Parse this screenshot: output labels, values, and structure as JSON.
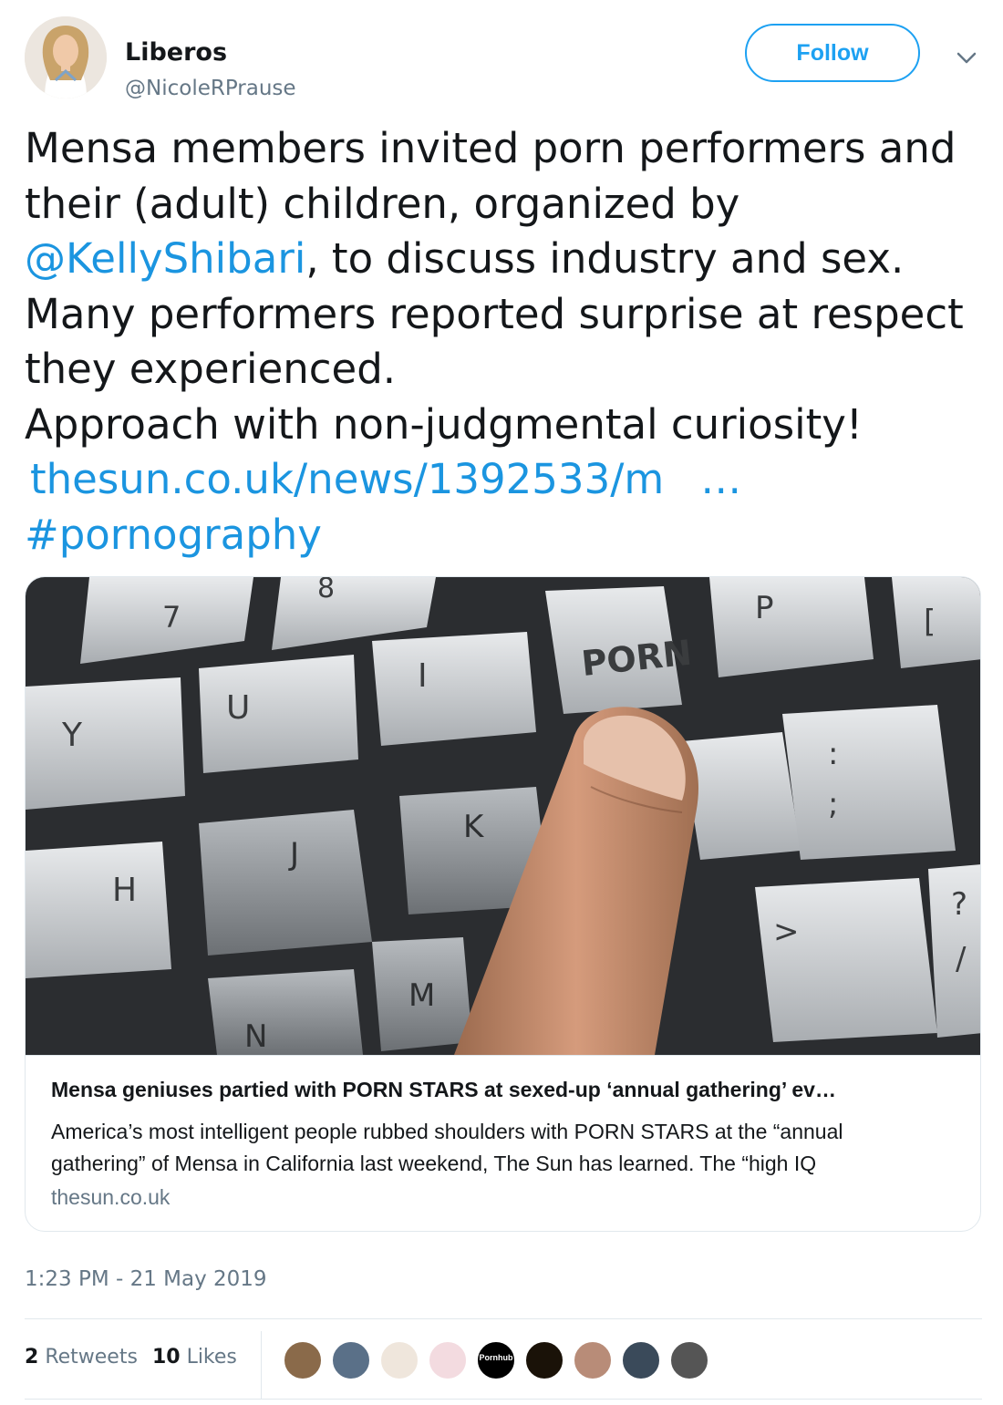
{
  "account": {
    "name": "Liberos",
    "handle": "@NicoleRPrause",
    "follow_label": "Follow"
  },
  "tweet": {
    "line1": "Mensa members invited porn performers and",
    "line2": "their (adult) children, organized by",
    "mention": "@KellyShibari",
    "line3_rest": ", to discuss industry and sex.",
    "line4": "Many performers reported surprise at respect",
    "line5": "they experienced.",
    "line6": "Approach with non-judgmental curiosity!",
    "url": "thesun.co.uk/news/1392533/m",
    "url_ellipsis": "…",
    "hashtag": "#pornography"
  },
  "card": {
    "image_key_labels": [
      "7",
      "8",
      "P",
      "[",
      "U",
      "I",
      "PORN",
      "Y",
      "H",
      "J",
      "K",
      "M",
      "N",
      ":",
      ";",
      "?",
      "/",
      ">"
    ],
    "title": "Mensa geniuses partied with PORN STARS at sexed-up ‘annual gathering’ ev…",
    "description_line1": "America’s most intelligent people rubbed shoulders with PORN STARS at the “annual",
    "description_line2": "gathering” of Mensa in California last weekend, The Sun has learned. The “high IQ",
    "domain": "thesun.co.uk"
  },
  "timestamp": "1:23 PM - 21 May 2019",
  "stats": {
    "retweets_count": "2",
    "retweets_label": "Retweets",
    "likes_count": "10",
    "likes_label": "Likes"
  },
  "likers": [
    {
      "name": "liker-1",
      "color": "#8a6a4a"
    },
    {
      "name": "liker-2",
      "color": "#5a7088"
    },
    {
      "name": "liker-3",
      "color": "#efe6dc"
    },
    {
      "name": "liker-4",
      "color": "#f3dbe0"
    },
    {
      "name": "liker-5",
      "color": "#000000",
      "label": "Pornhub"
    },
    {
      "name": "liker-6",
      "color": "#1a1208"
    },
    {
      "name": "liker-7",
      "color": "#b88c78"
    },
    {
      "name": "liker-8",
      "color": "#3a4a5a"
    },
    {
      "name": "liker-9",
      "color": "#555555"
    }
  ],
  "colors": {
    "accent": "#1da1f2",
    "link": "#1b95e0",
    "muted": "#657786",
    "border": "#e1e8ed"
  }
}
